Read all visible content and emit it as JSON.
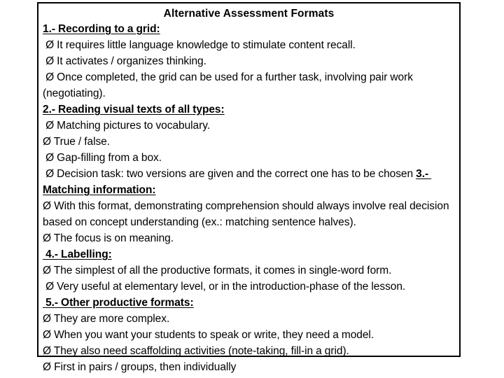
{
  "slide": {
    "title": "Alternative Assessment Formats",
    "body_lines": [
      {
        "id": "h1",
        "text": "1.- Recording to a grid:",
        "style": "heading"
      },
      {
        "id": "b1",
        "text": " Ø It requires little language knowledge to stimulate content recall.",
        "style": "body"
      },
      {
        "id": "b2",
        "text": " Ø It activates / organizes thinking.",
        "style": "body"
      },
      {
        "id": "b3",
        "text": " Ø Once completed, the grid can be used for a further task, involving pair work (negotiating).",
        "style": "body"
      },
      {
        "id": "h2",
        "text": "2.- Reading visual texts of all types:",
        "style": "heading"
      },
      {
        "id": "b4",
        "text": " Ø Matching pictures to vocabulary.",
        "style": "body"
      },
      {
        "id": "b5",
        "text": "Ø True / false.",
        "style": "body"
      },
      {
        "id": "b6",
        "text": " Ø Gap-filling from a box.",
        "style": "body"
      },
      {
        "id": "b7",
        "text": " Ø Decision task: two versions are given and the correct one has to be chosen ",
        "style": "body-with-inline-heading",
        "inline_heading": "3.- Matching information:"
      },
      {
        "id": "b8",
        "text": "Ø With this format, demonstrating comprehension should always involve real decision based on concept understanding (ex.: matching sentence halves).",
        "style": "body"
      },
      {
        "id": "b9",
        "text": "Ø The focus is on meaning.",
        "style": "body"
      },
      {
        "id": "h4",
        "text": " 4.- Labelling:",
        "style": "heading"
      },
      {
        "id": "b10",
        "text": "Ø The simplest of all the productive formats, it comes in single-word form.",
        "style": "body"
      },
      {
        "id": "b11",
        "text": " Ø Very useful at elementary level, or in the introduction-phase of the lesson.",
        "style": "body"
      },
      {
        "id": "h5",
        "text": " 5.- Other productive formats:",
        "style": "heading"
      },
      {
        "id": "b12",
        "text": "Ø They are more complex.",
        "style": "body"
      },
      {
        "id": "b13",
        "text": "Ø When you want your students to speak or write, they need a model.",
        "style": "body"
      },
      {
        "id": "b14",
        "text": "Ø They also need scaffolding activities (note-taking, fill-in a grid).",
        "style": "body"
      },
      {
        "id": "b15",
        "text": "Ø First in pairs / groups, then individually",
        "style": "body"
      }
    ],
    "colors": {
      "text": "#000000",
      "background": "#ffffff",
      "border": "#000000"
    },
    "bullet_glyph": "Ø"
  }
}
